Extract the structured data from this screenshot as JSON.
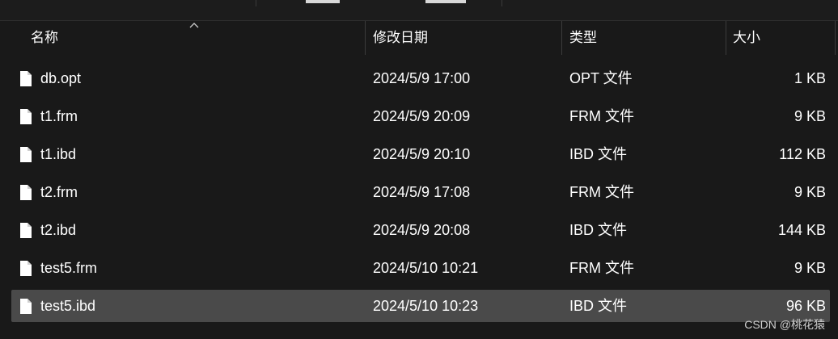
{
  "columns": {
    "name": "名称",
    "modified": "修改日期",
    "type": "类型",
    "size": "大小"
  },
  "files": [
    {
      "name": "db.opt",
      "modified": "2024/5/9 17:00",
      "type": "OPT 文件",
      "size": "1 KB"
    },
    {
      "name": "t1.frm",
      "modified": "2024/5/9 20:09",
      "type": "FRM 文件",
      "size": "9 KB"
    },
    {
      "name": "t1.ibd",
      "modified": "2024/5/9 20:10",
      "type": "IBD 文件",
      "size": "112 KB"
    },
    {
      "name": "t2.frm",
      "modified": "2024/5/9 17:08",
      "type": "FRM 文件",
      "size": "9 KB"
    },
    {
      "name": "t2.ibd",
      "modified": "2024/5/9 20:08",
      "type": "IBD 文件",
      "size": "144 KB"
    },
    {
      "name": "test5.frm",
      "modified": "2024/5/10 10:21",
      "type": "FRM 文件",
      "size": "9 KB"
    },
    {
      "name": "test5.ibd",
      "modified": "2024/5/10 10:23",
      "type": "IBD 文件",
      "size": "96 KB",
      "selected": true
    }
  ],
  "icons": {
    "file": "file-icon",
    "sort": "sort-ascending-icon"
  },
  "colors": {
    "background": "#191919",
    "selected_row": "#4a4a4a",
    "text": "#ffffff"
  },
  "watermark": "CSDN @桃花猿"
}
